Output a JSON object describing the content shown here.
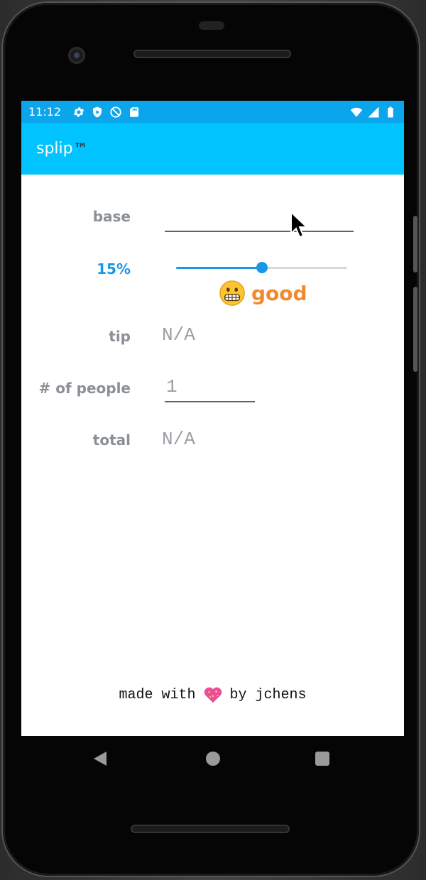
{
  "status_bar": {
    "time": "11:12",
    "left_icons": [
      "gear-icon",
      "shield-play-icon",
      "no-sync-icon",
      "sd-card-icon"
    ],
    "right_icons": [
      "wifi-icon",
      "cell-signal-icon",
      "battery-icon"
    ],
    "color": "#0aa5ea"
  },
  "app_bar": {
    "title": "splip",
    "title_suffix": "™",
    "color": "#00c3ff"
  },
  "form": {
    "base": {
      "label": "base",
      "value": ""
    },
    "tip_percent": {
      "label": "15%",
      "slider_fraction": 0.5,
      "rating_emoji": "grimacing-face-icon",
      "rating_text": "good",
      "rating_color": "#f08a2c"
    },
    "tip": {
      "label": "tip",
      "value": "N/A"
    },
    "people": {
      "label": "# of people",
      "value": "1"
    },
    "total": {
      "label": "total",
      "value": "N/A"
    }
  },
  "footer": {
    "prefix": "made with",
    "heart_icon": "sparkling-heart-icon",
    "suffix": "by jchens"
  },
  "nav_bar": {
    "icons": [
      "back-icon",
      "home-icon",
      "recents-icon"
    ]
  }
}
